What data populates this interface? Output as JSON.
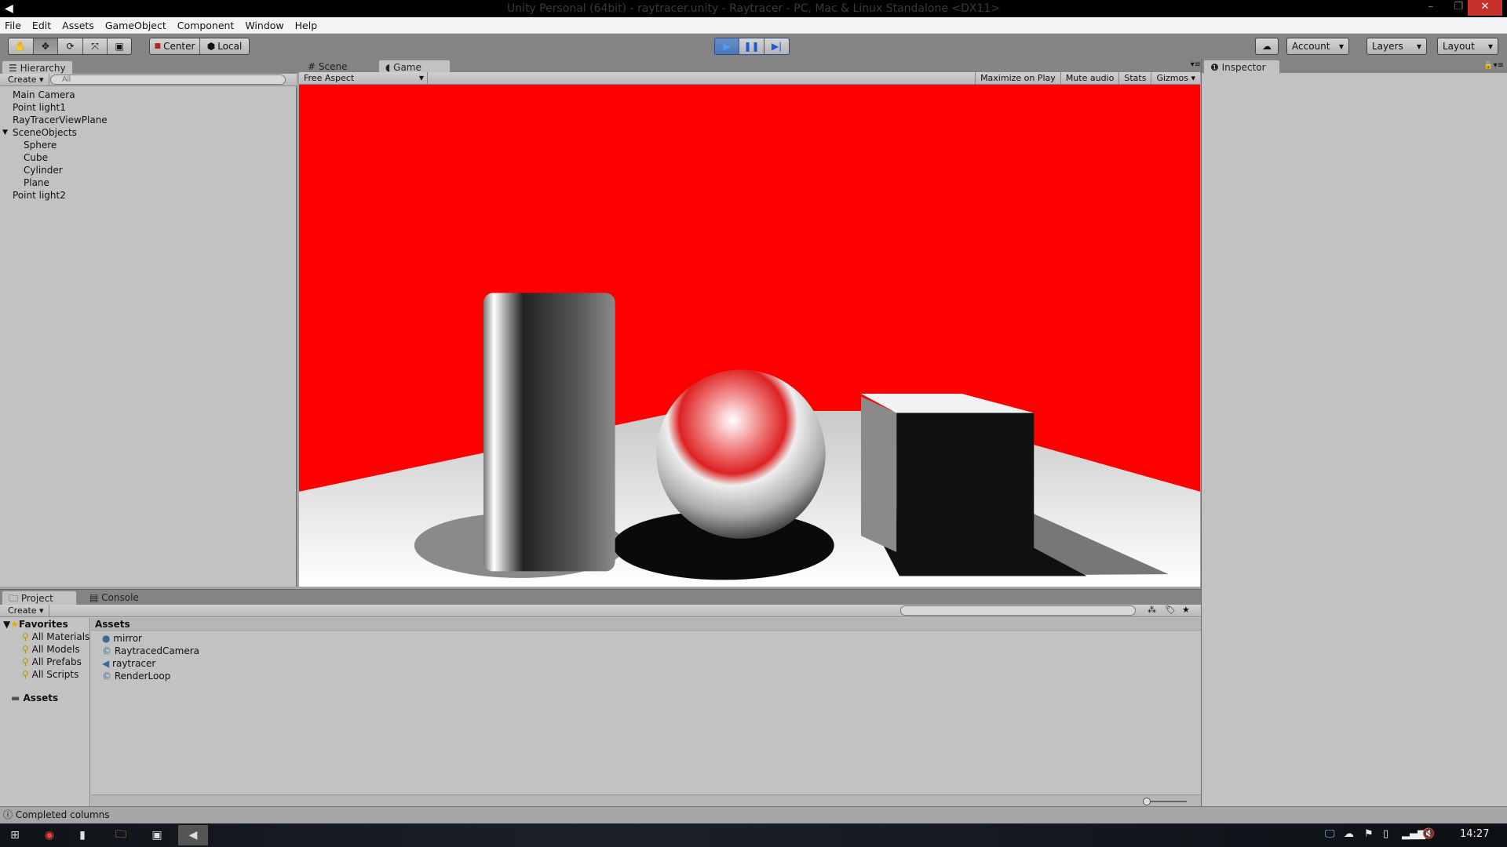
{
  "window": {
    "title": "Unity Personal (64bit) - raytracer.unity - Raytracer - PC, Mac & Linux Standalone <DX11>",
    "minimize": "–",
    "maximize": "❐",
    "close": "✕"
  },
  "menu": [
    "File",
    "Edit",
    "Assets",
    "GameObject",
    "Component",
    "Window",
    "Help"
  ],
  "toolbar": {
    "tools": [
      "hand-icon",
      "move-icon",
      "rotate-icon",
      "scale-icon",
      "rect-icon"
    ],
    "active_tool": "move-icon",
    "pivot": "Center",
    "space": "Local",
    "play_state": "playing",
    "account": "Account",
    "layers": "Layers",
    "layout": "Layout"
  },
  "hierarchy": {
    "tab": "Hierarchy",
    "create": "Create",
    "search_placeholder": "All",
    "items": [
      {
        "label": "Main Camera",
        "depth": 0
      },
      {
        "label": "Point light1",
        "depth": 0
      },
      {
        "label": "RayTracerViewPlane",
        "depth": 0
      },
      {
        "label": "SceneObjects",
        "depth": 0,
        "expanded": true
      },
      {
        "label": "Sphere",
        "depth": 1
      },
      {
        "label": "Cube",
        "depth": 1
      },
      {
        "label": "Cylinder",
        "depth": 1
      },
      {
        "label": "Plane",
        "depth": 1
      },
      {
        "label": "Point light2",
        "depth": 0
      }
    ]
  },
  "game": {
    "tabs": [
      "Scene",
      "Game"
    ],
    "active_tab": "Game",
    "aspect": "Free Aspect",
    "buttons": [
      "Maximize on Play",
      "Mute audio",
      "Stats",
      "Gizmos"
    ],
    "background_color": "#ff0000"
  },
  "inspector": {
    "tab": "Inspector"
  },
  "project": {
    "tabs": [
      "Project",
      "Console"
    ],
    "create": "Create",
    "favorites_label": "Favorites",
    "favorites": [
      "All Materials",
      "All Models",
      "All Prefabs",
      "All Scripts"
    ],
    "assets_root": "Assets",
    "assets_header": "Assets",
    "assets": [
      {
        "name": "mirror",
        "icon": "material-sphere-icon"
      },
      {
        "name": "RaytracedCamera",
        "icon": "csharp-script-icon"
      },
      {
        "name": "raytracer",
        "icon": "unity-scene-icon"
      },
      {
        "name": "RenderLoop",
        "icon": "csharp-script-icon"
      }
    ]
  },
  "status": {
    "text": "Completed columns"
  },
  "taskbar": {
    "time": "14:27"
  }
}
